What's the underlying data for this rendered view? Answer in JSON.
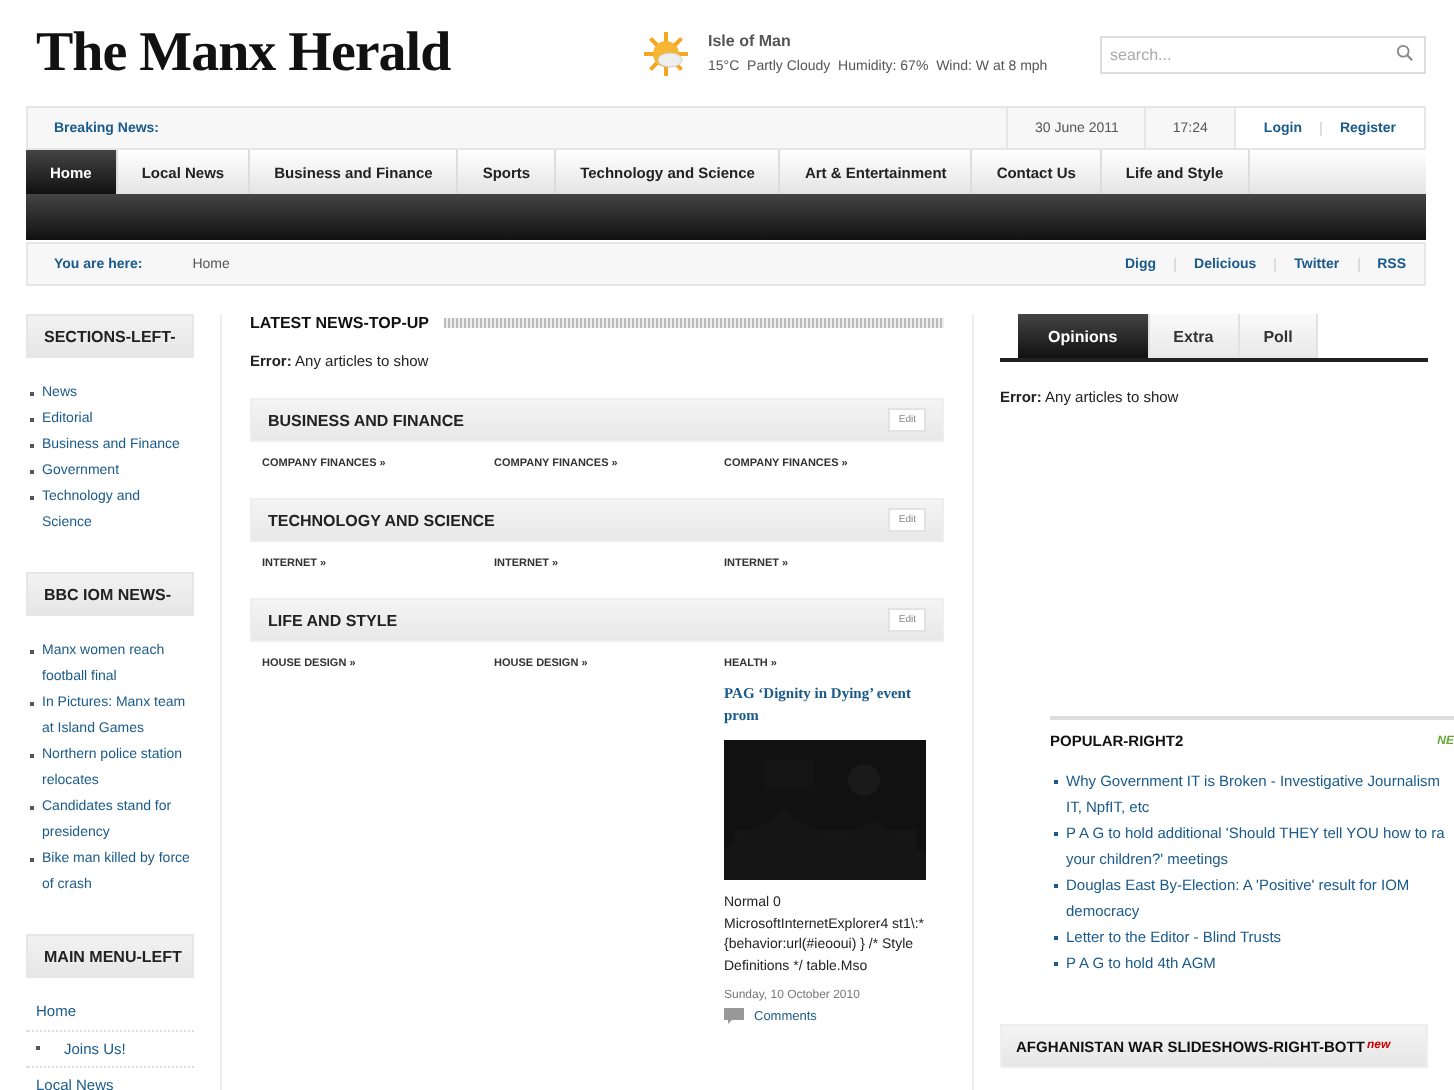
{
  "logo": "The Manx Herald",
  "weather": {
    "place": "Isle of Man",
    "details": "15°C  Partly Cloudy  Humidity: 67%  Wind: W at 8 mph"
  },
  "search": {
    "placeholder": "search..."
  },
  "top_bar": {
    "breaking_label": "Breaking News:",
    "date": "30 June 2011",
    "time": "17:24",
    "links": [
      "Login",
      "Register"
    ]
  },
  "nav": [
    {
      "label": "Home",
      "selected": true
    },
    {
      "label": "Local News",
      "selected": false
    },
    {
      "label": "Business and Finance",
      "selected": false
    },
    {
      "label": "Sports",
      "selected": false
    },
    {
      "label": "Technology and Science",
      "selected": false
    },
    {
      "label": "Art & Entertainment",
      "selected": false
    },
    {
      "label": "Contact Us",
      "selected": false
    },
    {
      "label": "Life and Style",
      "selected": false
    }
  ],
  "breadcrumb": {
    "label": "You are here:",
    "current": "Home",
    "social": [
      "Digg",
      "Delicious",
      "Twitter",
      "RSS"
    ]
  },
  "left": [
    {
      "title": "SECTIONS-LEFT-",
      "kind": "bullets",
      "items": [
        "News",
        "Editorial",
        "Business and Finance",
        "Government",
        "Technology and Science"
      ]
    },
    {
      "title": "BBC IOM NEWS-",
      "kind": "bullets",
      "items": [
        "Manx women reach football final",
        "In Pictures: Manx team at Island Games",
        "Northern police station relocates",
        "Candidates stand for presidency",
        "Bike man killed by force of crash"
      ]
    },
    {
      "title": "MAIN MENU-LEFT",
      "kind": "menu",
      "items": [
        "Home",
        "Joins Us!",
        "Local News"
      ]
    }
  ],
  "center": {
    "title": "LATEST NEWS-TOP-UP",
    "error_label": "Error:",
    "error_text": "Any articles to show",
    "sections": [
      {
        "title": "BUSINESS AND FINANCE",
        "edit": "Edit",
        "links": [
          "COMPANY FINANCES »",
          "COMPANY FINANCES »",
          "COMPANY FINANCES »"
        ]
      },
      {
        "title": "TECHNOLOGY AND SCIENCE",
        "edit": "Edit",
        "links": [
          "INTERNET »",
          "INTERNET »",
          "INTERNET »"
        ]
      },
      {
        "title": "LIFE AND STYLE",
        "edit": "Edit",
        "links": [
          "HOUSE DESIGN »",
          "HOUSE DESIGN »",
          "HEALTH »"
        ]
      }
    ],
    "article": {
      "title": "PAG ‘Dignity in Dying’ event prom",
      "excerpt": "Normal 0 MicrosoftInternetExplorer4 st1\\:*{behavior:url(#ieooui) } /* Style Definitions */ table.Mso",
      "date": "Sunday, 10 October 2010",
      "comments": "Comments"
    }
  },
  "right": {
    "tabs": [
      {
        "label": "Opinions",
        "selected": true
      },
      {
        "label": "Extra",
        "selected": false
      },
      {
        "label": "Poll",
        "selected": false
      }
    ],
    "error_label": "Error:",
    "error_text": "Any articles to show",
    "popular": {
      "title": "POPULAR-RIGHT2",
      "badge": "NE",
      "items": [
        [
          "Why Government IT is Broken - Investigative Journalism",
          "IT, NpfIT, etc"
        ],
        [
          "P A G to hold additional 'Should THEY tell YOU how to ra",
          "your children?' meetings"
        ],
        [
          "Douglas East By-Election: A 'Positive' result for IOM",
          "democracy"
        ],
        [
          "Letter to the Editor - Blind Trusts"
        ],
        [
          "P A G to hold 4th AGM"
        ]
      ]
    },
    "bottom_title": "AFGHANISTAN WAR SLIDESHOWS-RIGHT-BOTT",
    "bottom_badge": "new"
  }
}
